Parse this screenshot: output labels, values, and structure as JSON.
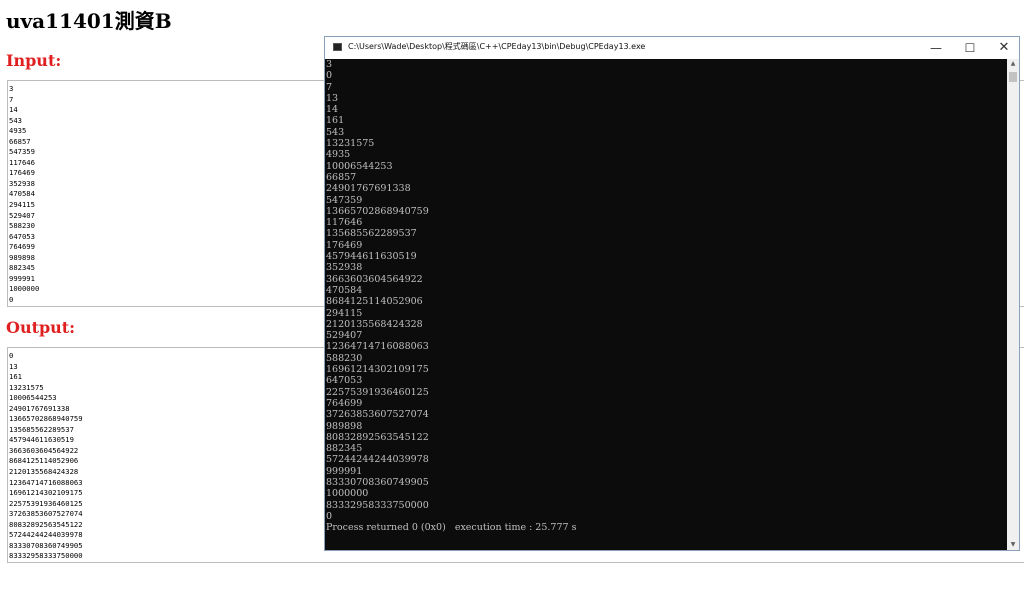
{
  "page": {
    "title": "uva11401測資B",
    "input_heading": "Input:",
    "output_heading": "Output:"
  },
  "input_lines": [
    "3",
    "7",
    "14",
    "543",
    "4935",
    "66857",
    "547359",
    "117646",
    "176469",
    "352938",
    "470584",
    "294115",
    "529407",
    "588230",
    "647053",
    "764699",
    "989898",
    "882345",
    "999991",
    "1000000",
    "0"
  ],
  "output_lines": [
    "0",
    "13",
    "161",
    "13231575",
    "10006544253",
    "2490176769133​8",
    "13665702868940759",
    "135685562289537",
    "457944611630519",
    "3663603604564922",
    "8684125114052906",
    "2120135568424328",
    "12364714716088063",
    "16961214302109175",
    "22575391936460125",
    "37263853607527074",
    "80832892563545122",
    "57244244244039978",
    "83330708360749905",
    "83332958333750000"
  ],
  "console": {
    "title": "C:\\Users\\Wade\\Desktop\\程式碼區\\C++\\CPEday13\\bin\\Debug\\CPEday13.exe",
    "minimize_glyph": "—",
    "maximize_glyph": "☐",
    "close_glyph": "✕",
    "lines": [
      "3",
      "0",
      "7",
      "13",
      "14",
      "161",
      "543",
      "13231575",
      "4935",
      "10006544253",
      "66857",
      "24901767691338",
      "547359",
      "13665702868940759",
      "117646",
      "135685562289537",
      "176469",
      "457944611630519",
      "352938",
      "3663603604564922",
      "470584",
      "8684125114052906",
      "294115",
      "2120135568424328",
      "529407",
      "12364714716088063",
      "588230",
      "16961214302109175",
      "647053",
      "22575391936460125",
      "764699",
      "37263853607527074",
      "989898",
      "80832892563545122",
      "882345",
      "57244244244039978",
      "999991",
      "83330708360749905",
      "1000000",
      "83332958333750000",
      "0"
    ],
    "status": "Process returned 0 (0x0)   execution time : 25.777 s"
  },
  "colors": {
    "heading_red": "#e02020",
    "console_bg": "#0c0c0c",
    "console_text": "#c0c0c0"
  },
  "icons": {
    "app": "console-app-icon",
    "scroll_up": "arrow-up-icon",
    "scroll_down": "arrow-down-icon"
  }
}
